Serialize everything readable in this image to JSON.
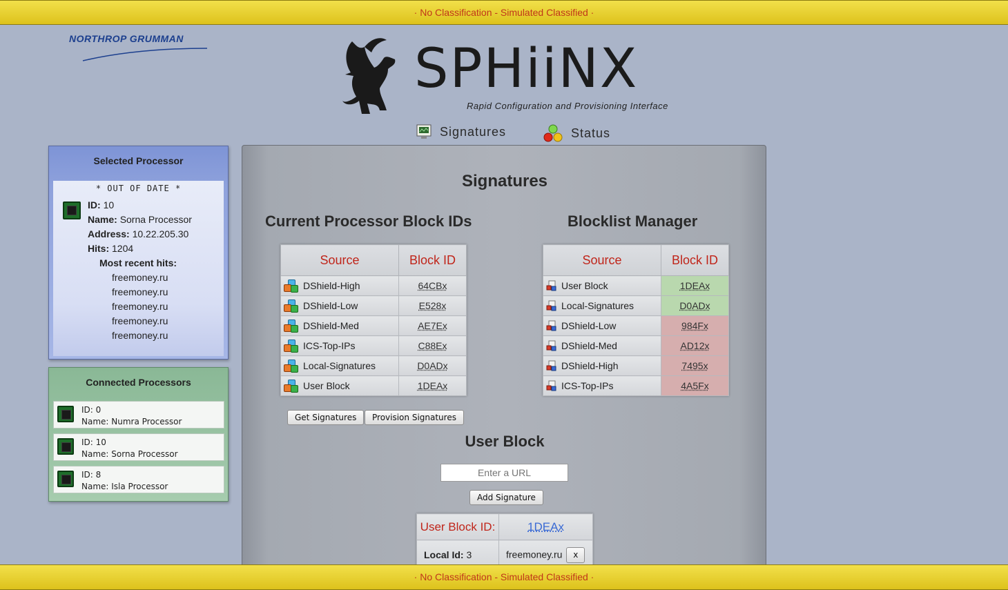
{
  "banner": {
    "text": "· No Classification - Simulated Classified ·"
  },
  "header": {
    "company_logo": "NORTHROP GRUMMAN",
    "app_title": "SPHiiNX",
    "app_subtitle": "Rapid Configuration and Provisioning Interface",
    "nav": [
      {
        "label": "Signatures",
        "icon": "monitor-icon"
      },
      {
        "label": "Status",
        "icon": "traffic-lights-icon"
      }
    ]
  },
  "selected_processor": {
    "title": "Selected Processor",
    "status": "* OUT OF DATE *",
    "id_label": "ID:",
    "id": "10",
    "name_label": "Name:",
    "name": "Sorna Processor",
    "address_label": "Address:",
    "address": "10.22.205.30",
    "hits_label": "Hits:",
    "hits": "1204",
    "recent_label": "Most recent hits:",
    "recent_hits": [
      "freemoney.ru",
      "freemoney.ru",
      "freemoney.ru",
      "freemoney.ru",
      "freemoney.ru"
    ]
  },
  "connected_processors": {
    "title": "Connected Processors",
    "items": [
      {
        "id": "ID: 0",
        "name": "Name: Numra Processor"
      },
      {
        "id": "ID: 10",
        "name": "Name: Sorna Processor"
      },
      {
        "id": "ID: 8",
        "name": "Name: Isla Processor"
      }
    ]
  },
  "main": {
    "title": "Signatures",
    "current": {
      "title": "Current Processor Block IDs",
      "headers": [
        "Source",
        "Block ID"
      ],
      "rows": [
        {
          "source": "DShield-High",
          "id": "64CBx"
        },
        {
          "source": "DShield-Low",
          "id": "E528x"
        },
        {
          "source": "DShield-Med",
          "id": "AE7Ex"
        },
        {
          "source": "ICS-Top-IPs",
          "id": "C88Ex"
        },
        {
          "source": "Local-Signatures",
          "id": "D0ADx"
        },
        {
          "source": "User Block",
          "id": "1DEAx"
        }
      ]
    },
    "manager": {
      "title": "Blocklist Manager",
      "headers": [
        "Source",
        "Block ID"
      ],
      "rows": [
        {
          "source": "User Block",
          "id": "1DEAx",
          "state": "green"
        },
        {
          "source": "Local-Signatures",
          "id": "D0ADx",
          "state": "green"
        },
        {
          "source": "DShield-Low",
          "id": "984Fx",
          "state": "red"
        },
        {
          "source": "DShield-Med",
          "id": "AD12x",
          "state": "red"
        },
        {
          "source": "DShield-High",
          "id": "7495x",
          "state": "red"
        },
        {
          "source": "ICS-Top-IPs",
          "id": "4A5Fx",
          "state": "red"
        }
      ]
    },
    "get_button": "Get Signatures",
    "provision_button": "Provision Signatures",
    "user_block": {
      "title": "User Block",
      "url_placeholder": "Enter a URL",
      "add_button": "Add Signature",
      "id_label": "User Block ID:",
      "id_value": "1DEAx",
      "local_label": "Local Id:",
      "local_value": "3",
      "entry": "freemoney.ru",
      "remove_label": "x"
    }
  },
  "colors": {
    "banner": "#e8d232",
    "banner_text": "#c0361a",
    "header_red": "#c0251a",
    "green_cell": "#b9d8ae",
    "red_cell": "#d6aeae",
    "selected_panel": "#8fa2dc",
    "connected_panel": "#9cc4a4"
  }
}
